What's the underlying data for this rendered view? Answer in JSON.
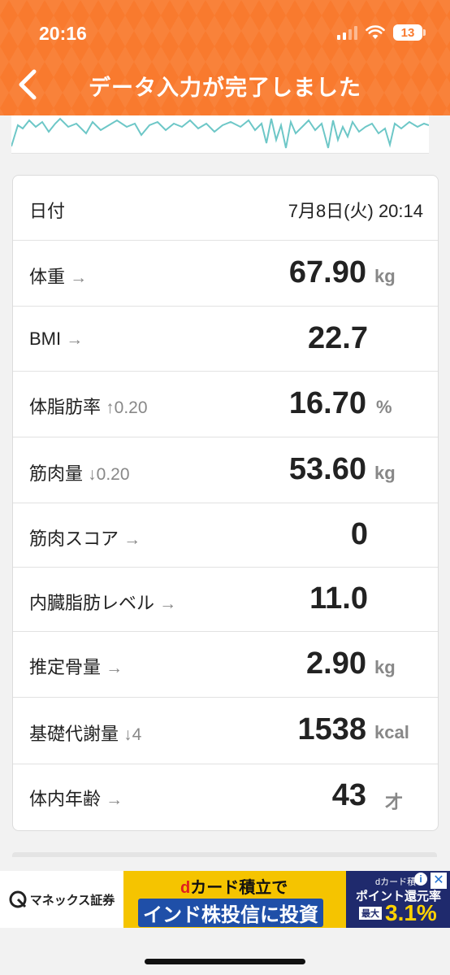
{
  "status_bar": {
    "time": "20:16",
    "battery": "13"
  },
  "nav": {
    "title": "データ入力が完了しました",
    "back_icon": "chevron-left-icon"
  },
  "colors": {
    "header": "#f97a2e",
    "graph_line": "#6dc7c7"
  },
  "record": {
    "date_label": "日付",
    "date_value": "7月8日(火) 20:14",
    "rows": [
      {
        "label": "体重",
        "trend": "→",
        "delta": "",
        "value": "67.90",
        "unit": "kg"
      },
      {
        "label": "BMI",
        "trend": "→",
        "delta": "",
        "value": "22.7",
        "unit": ""
      },
      {
        "label": "体脂肪率",
        "trend": "↑",
        "delta": "0.20",
        "value": "16.70",
        "unit": "%"
      },
      {
        "label": "筋肉量",
        "trend": "↓",
        "delta": "0.20",
        "value": "53.60",
        "unit": "kg"
      },
      {
        "label": "筋肉スコア",
        "trend": "→",
        "delta": "",
        "value": "0",
        "unit": ""
      },
      {
        "label": "内臓脂肪レベル",
        "trend": "→",
        "delta": "",
        "value": "11.0",
        "unit": ""
      },
      {
        "label": "推定骨量",
        "trend": "→",
        "delta": "",
        "value": "2.90",
        "unit": "kg"
      },
      {
        "label": "基礎代謝量",
        "trend": "↓",
        "delta": "4",
        "value": "1538",
        "unit": "kcal"
      },
      {
        "label": "体内年齢",
        "trend": "→",
        "delta": "",
        "value": "43",
        "unit": "才"
      }
    ]
  },
  "ad": {
    "brand": "マネックス証券",
    "headline_d": "d",
    "headline_rest": "カード積立で",
    "subline": "インド株投信に投資",
    "right_top": "dカード積",
    "right_mid": "ポイント還元率",
    "right_max": "最大",
    "right_rate": "3.1%",
    "info_icon": "info-icon",
    "close_icon": "close-icon"
  }
}
